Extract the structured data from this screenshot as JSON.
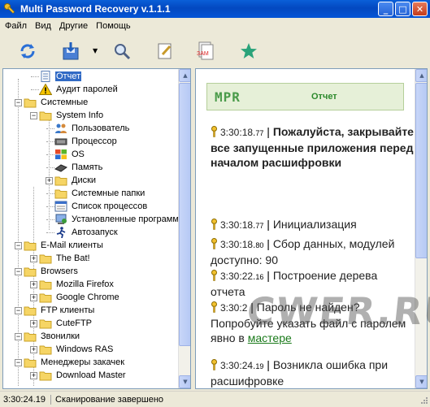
{
  "window": {
    "title": "Multi Password Recovery v.1.1.1"
  },
  "menu": [
    "Файл",
    "Вид",
    "Другие",
    "Помощь"
  ],
  "toolbar": [
    {
      "name": "refresh-icon"
    },
    {
      "name": "save-icon"
    },
    {
      "name": "search-icon"
    },
    {
      "name": "edit-icon"
    },
    {
      "name": "report-icon",
      "label": "ЗАМ"
    },
    {
      "name": "star-icon"
    }
  ],
  "tree": [
    {
      "label": "Отчет",
      "icon": "doc",
      "selected": true
    },
    {
      "label": "Аудит паролей",
      "icon": "warn"
    },
    {
      "label": "Системные",
      "icon": "folder"
    },
    {
      "label": "System Info",
      "icon": "folder"
    },
    {
      "label": "Пользователь",
      "icon": "users"
    },
    {
      "label": "Процессор",
      "icon": "cpu"
    },
    {
      "label": "OS",
      "icon": "win"
    },
    {
      "label": "Память",
      "icon": "ram"
    },
    {
      "label": "Диски",
      "icon": "folder"
    },
    {
      "label": "Системные папки",
      "icon": "folder"
    },
    {
      "label": "Список процессов",
      "icon": "proc"
    },
    {
      "label": "Установленные программы",
      "icon": "prog"
    },
    {
      "label": "Автозапуск",
      "icon": "run"
    },
    {
      "label": "E-Mail клиенты",
      "icon": "folder"
    },
    {
      "label": "The Bat!",
      "icon": "folder"
    },
    {
      "label": "Browsers",
      "icon": "folder"
    },
    {
      "label": "Mozilla Firefox",
      "icon": "folder"
    },
    {
      "label": "Google Chrome",
      "icon": "folder"
    },
    {
      "label": "FTP клиенты",
      "icon": "folder"
    },
    {
      "label": "CuteFTP",
      "icon": "folder"
    },
    {
      "label": "Звонилки",
      "icon": "folder"
    },
    {
      "label": "Windows RAS",
      "icon": "folder"
    },
    {
      "label": "Менеджеры закачек",
      "icon": "folder"
    },
    {
      "label": "Download Master",
      "icon": "folder"
    }
  ],
  "report": {
    "logo": "MPR",
    "title": "Отчет",
    "entries": [
      {
        "time": "3:30:18.",
        "ms": "77",
        "msg": "Пожалуйста, закрывайте все запущенные приложения перед началом расшифровки"
      },
      {
        "time": "3:30:18.",
        "ms": "77",
        "msg": "Инициализация"
      },
      {
        "time": "3:30:18.",
        "ms": "80",
        "msg": "Сбор данных, модулей доступно: 90"
      },
      {
        "time": "3:30:22.",
        "ms": "16",
        "msg": "Построение дерева отчета"
      },
      {
        "time": "3:30:2",
        "ms": "",
        "msg": "Пароль не найден? Попробуйте указать файл с паролем явно в ",
        "link": "мастере"
      },
      {
        "time": "3:30:24.",
        "ms": "19",
        "msg": "Возникла ошибка при расшифровке"
      }
    ]
  },
  "watermark": "CWER.RU",
  "status": {
    "time": "3:30:24.19",
    "message": "Сканирование завершено"
  }
}
